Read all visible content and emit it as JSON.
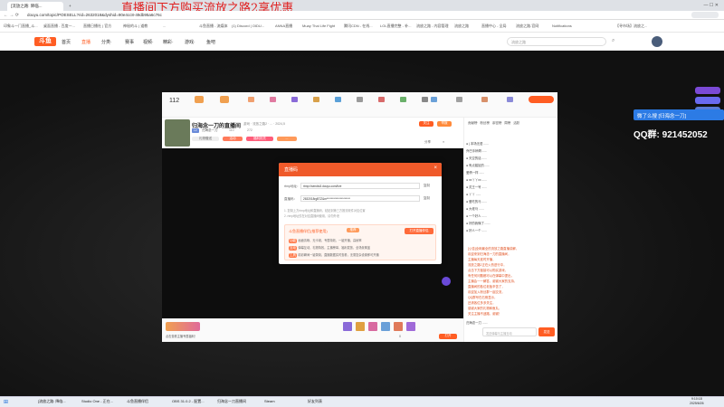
{
  "browser": {
    "tabs": [
      {
        "label": "[流放之路: 降临..."
      },
      {
        "label": "+"
      }
    ],
    "url": "douyu.com/topic/POESELL?rid=2632018&dyshid=90e4cc8-49db95a6c76c"
  },
  "bookmarks": [
    "印象斗一门直播_斗...",
    "桌面直播 - 百度一...",
    "直播日播社 | 官方",
    "神秘的斗 | 道教",
    "...",
    "斗鱼直播 - 流媒体",
    "(1) Discord | OIDU...",
    "ANNA直播",
    "Muay Thai Life Fight",
    "腾讯CDN - 在线...",
    "LOL直播完整 - 补...",
    "流放之路 - 内容管理",
    "流放之路",
    "直播中心 - 全局",
    "流放之路-官网",
    "Notifications",
    "【寻市场】流放之..."
  ],
  "banner": "直播间下方购买流放之路2享优惠",
  "site": {
    "logo": "斗鱼",
    "nav": [
      "首页",
      "直播",
      "分类·",
      "赛事",
      "视频·",
      "精彩·",
      "游戏·",
      "鱼吧"
    ],
    "search_placeholder": "流放之路"
  },
  "room": {
    "title": "归海念一刀的直播间",
    "tags": [
      "游戏",
      "流放之路2",
      "...",
      "2024,5"
    ],
    "follow": "关注",
    "report": "举报",
    "share": "分享",
    "more": "≡",
    "streamer_badge": "LV",
    "streamer_name": "归海念一刀",
    "stats": [
      "112",
      "110",
      "272"
    ],
    "chips": [
      "礼物赠送",
      "活动",
      "福利抢先",
      "..."
    ],
    "top_icons": [
      "签到",
      "鱼丸",
      "钻粉",
      "贵族",
      "电竞",
      "主播任务",
      "粉丝牌",
      "VIP",
      "开通贵族",
      "下载",
      "收藏",
      "更多"
    ]
  },
  "rank": {
    "tab1": "贡献榜",
    "tab2": "粉丝榜",
    "tab3": "亲密榜",
    "tab4": "周榜",
    "tab5": "活跃"
  },
  "chat": [
    "●  | 本场无语 ......",
    "乔巴手柄哥......",
    "●  天空的话 ......",
    "● 有点尴尬的......",
    "爱情一样 ......",
    "●  xx丫丫xx ......",
    "● 灵王一号 ......",
    "● 丫丫 ......",
    "● 爱吃的马 ......",
    "● 大佬马 ......",
    "● 一个好人 ......",
    "● 好的我懂了.......",
    "● 好人一个 ......",
    "归海念一刀 ......"
  ],
  "notice": [
    "[公告]全网最全的流放之路直播讲解，",
    "欢迎来到归海念一刀的直播间，",
    "主播每天准时开播，",
    "流放之路2正在火热进行中，",
    "点击下方链接可以购买游戏，",
    "有任何问题都可以在弹幕中提出，",
    "主播会一一解答，谢谢大家的支持，",
    "直播间的各位老板辛苦了，",
    "欢迎加入粉丝群一起交流，",
    "QQ群号在右侧显示，",
    "还请各位多多关注，",
    "感谢大家的礼物和鱼丸，",
    "关注主播不迷路，谢谢！"
  ],
  "modal": {
    "title": "直播码",
    "rtmp_label": "rtmp地址：",
    "rtmp_value": "rtmp://sendtc3.douyu.com/live",
    "code_label": "直播码：",
    "code_value": "2632018rgB7Z&m*********************",
    "copy": "复制",
    "tip1": "1. 复制上方rtmp地址和直播码，粘贴到第三方推流软件对应位置",
    "tip2": "2. rtmp地址仅在对应直播间使用，请勿外泄",
    "promo_title": "斗鱼直播伴侣(推荐使用)",
    "promo_tag": "推荐",
    "open_btn": "打开直播伴侣",
    "features": [
      {
        "tag": "功能",
        "text": "画面清晰，无卡顿，专属特效，一键开播，高帧率"
      },
      {
        "tag": "互动",
        "text": "弹幕互动，礼物特效，主播榜单，福利发放，全场景覆盖"
      },
      {
        "tag": "工具",
        "text": "精彩瞬间一键录制，直播数据实时查看，无需复杂设置即可开播"
      }
    ]
  },
  "qq": {
    "ad": "微了么搜 [归海念一刀]",
    "group_label": "QQ群:",
    "group_num": "921452052"
  },
  "player_bottom": {
    "sub_label": "点击查看主播专属福利！",
    "gift_count": "0",
    "send": "发送",
    "chat_placeholder": "发送弹幕与主播互动",
    "btn_open": "打开"
  },
  "taskbar": {
    "apps": [
      "[流放之路: 降临...",
      "Studio One - 正在...",
      "斗鱼直播伴侣",
      "OBS 31.0.2 - 配置...",
      "归海念一刀直播间",
      "Steam",
      "好友列表"
    ],
    "time": "9:10:18",
    "date": "2025/6/26"
  },
  "colors": {
    "accent": "#ff5d23",
    "nav_active": "#ff5d23",
    "modal_header": "#ef5a2a",
    "promo": "#ff6a3a",
    "qq_blue": "#1e7de0"
  }
}
